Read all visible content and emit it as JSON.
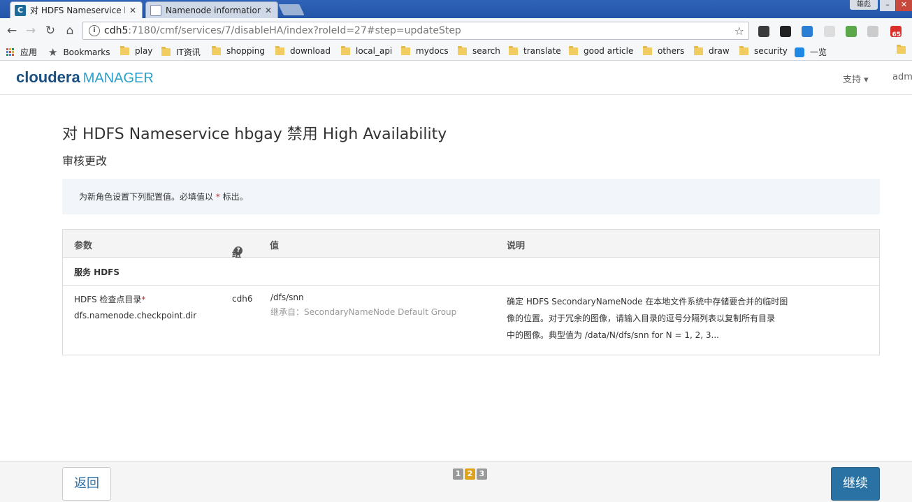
{
  "browser": {
    "tabs": [
      {
        "title": "对 HDFS Nameservice h",
        "favicon": "C",
        "active": true
      },
      {
        "title": "Namenode information",
        "active": false
      }
    ],
    "window_user": "雄彪",
    "address": {
      "host": "cdh5",
      "path": ":7180/cmf/services/7/disableHA/index?roleId=27#step=updateStep"
    },
    "bookmarks": [
      {
        "label": "应用",
        "icon": "apps-grid-icon"
      },
      {
        "label": "Bookmarks",
        "icon": "star-icon"
      },
      {
        "label": "play",
        "icon": "folder-icon"
      },
      {
        "label": "IT资讯",
        "icon": "folder-icon"
      },
      {
        "label": "shopping",
        "icon": "folder-icon"
      },
      {
        "label": "download",
        "icon": "folder-icon"
      },
      {
        "label": "local_api",
        "icon": "folder-icon"
      },
      {
        "label": "mydocs",
        "icon": "folder-icon"
      },
      {
        "label": "search",
        "icon": "folder-icon"
      },
      {
        "label": "translate",
        "icon": "folder-icon"
      },
      {
        "label": "good article",
        "icon": "folder-icon"
      },
      {
        "label": "others",
        "icon": "folder-icon"
      },
      {
        "label": "draw",
        "icon": "folder-icon"
      },
      {
        "label": "security",
        "icon": "folder-icon"
      },
      {
        "label": "一览",
        "icon": "yilan-icon"
      }
    ],
    "extension_badge": "65"
  },
  "app": {
    "logo_main": "cloudera",
    "logo_sub": "MANAGER",
    "support_menu": "支持 ▾",
    "user_menu": "adm"
  },
  "page": {
    "title": "对 HDFS Nameservice hbgay 禁用 High Availability",
    "subtitle": "审核更改",
    "notice_prefix": "为新角色设置下列配置值。必填值以 ",
    "notice_star": "*",
    "notice_suffix": " 标出。"
  },
  "table": {
    "headers": {
      "param": "参数",
      "group": "组",
      "value": "值",
      "description": "说明"
    },
    "section": "服务 HDFS",
    "rows": [
      {
        "param_label": "HDFS 检查点目录",
        "required": "*",
        "param_key": "dfs.namenode.checkpoint.dir",
        "group": "cdh6",
        "value": "/dfs/snn",
        "inherited": "继承自：SecondaryNameNode Default Group",
        "description_lines": [
          "确定 HDFS SecondaryNameNode 在本地文件系统中存储要合并的临时图",
          "像的位置。对于冗余的图像，请输入目录的逗号分隔列表以复制所有目录",
          "中的图像。典型值为 /data/N/dfs/snn for N = 1, 2, 3..."
        ]
      }
    ]
  },
  "footer": {
    "back_label": "返回",
    "next_label": "继续",
    "steps": [
      "1",
      "2",
      "3"
    ],
    "active_step": "2"
  }
}
